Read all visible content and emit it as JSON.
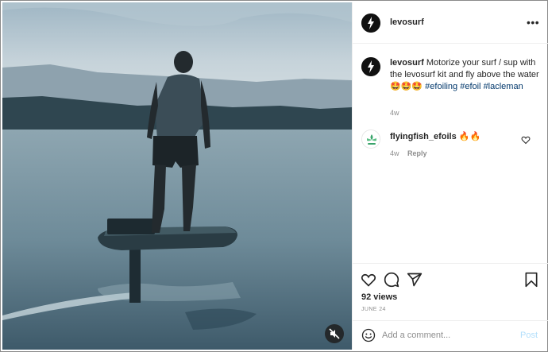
{
  "post": {
    "author": "levosurf",
    "more_icon": "more-horizontal-icon",
    "caption": {
      "username": "levosurf",
      "text": "Motorize your surf / sup with the levosurf kit and fly above the water 🤩🤩🤩",
      "hashtags": [
        "#efoiling",
        "#efoil",
        "#lacleman"
      ],
      "time": "4w"
    },
    "comments": [
      {
        "username": "flyingfish_efoils",
        "text": "🔥🔥",
        "time": "4w",
        "reply_label": "Reply"
      }
    ],
    "actions": {
      "like_icon": "heart-icon",
      "comment_icon": "comment-icon",
      "share_icon": "share-icon",
      "save_icon": "bookmark-icon"
    },
    "views": "92 views",
    "date": "JUNE 24",
    "add_comment": {
      "placeholder": "Add a comment...",
      "post_label": "Post",
      "emoji_icon": "smiley-icon"
    },
    "media": {
      "mute_icon": "speaker-muted-icon"
    }
  },
  "colors": {
    "link": "#00376b",
    "muted": "#8e8e8e",
    "post_disabled": "#b2dffc"
  }
}
